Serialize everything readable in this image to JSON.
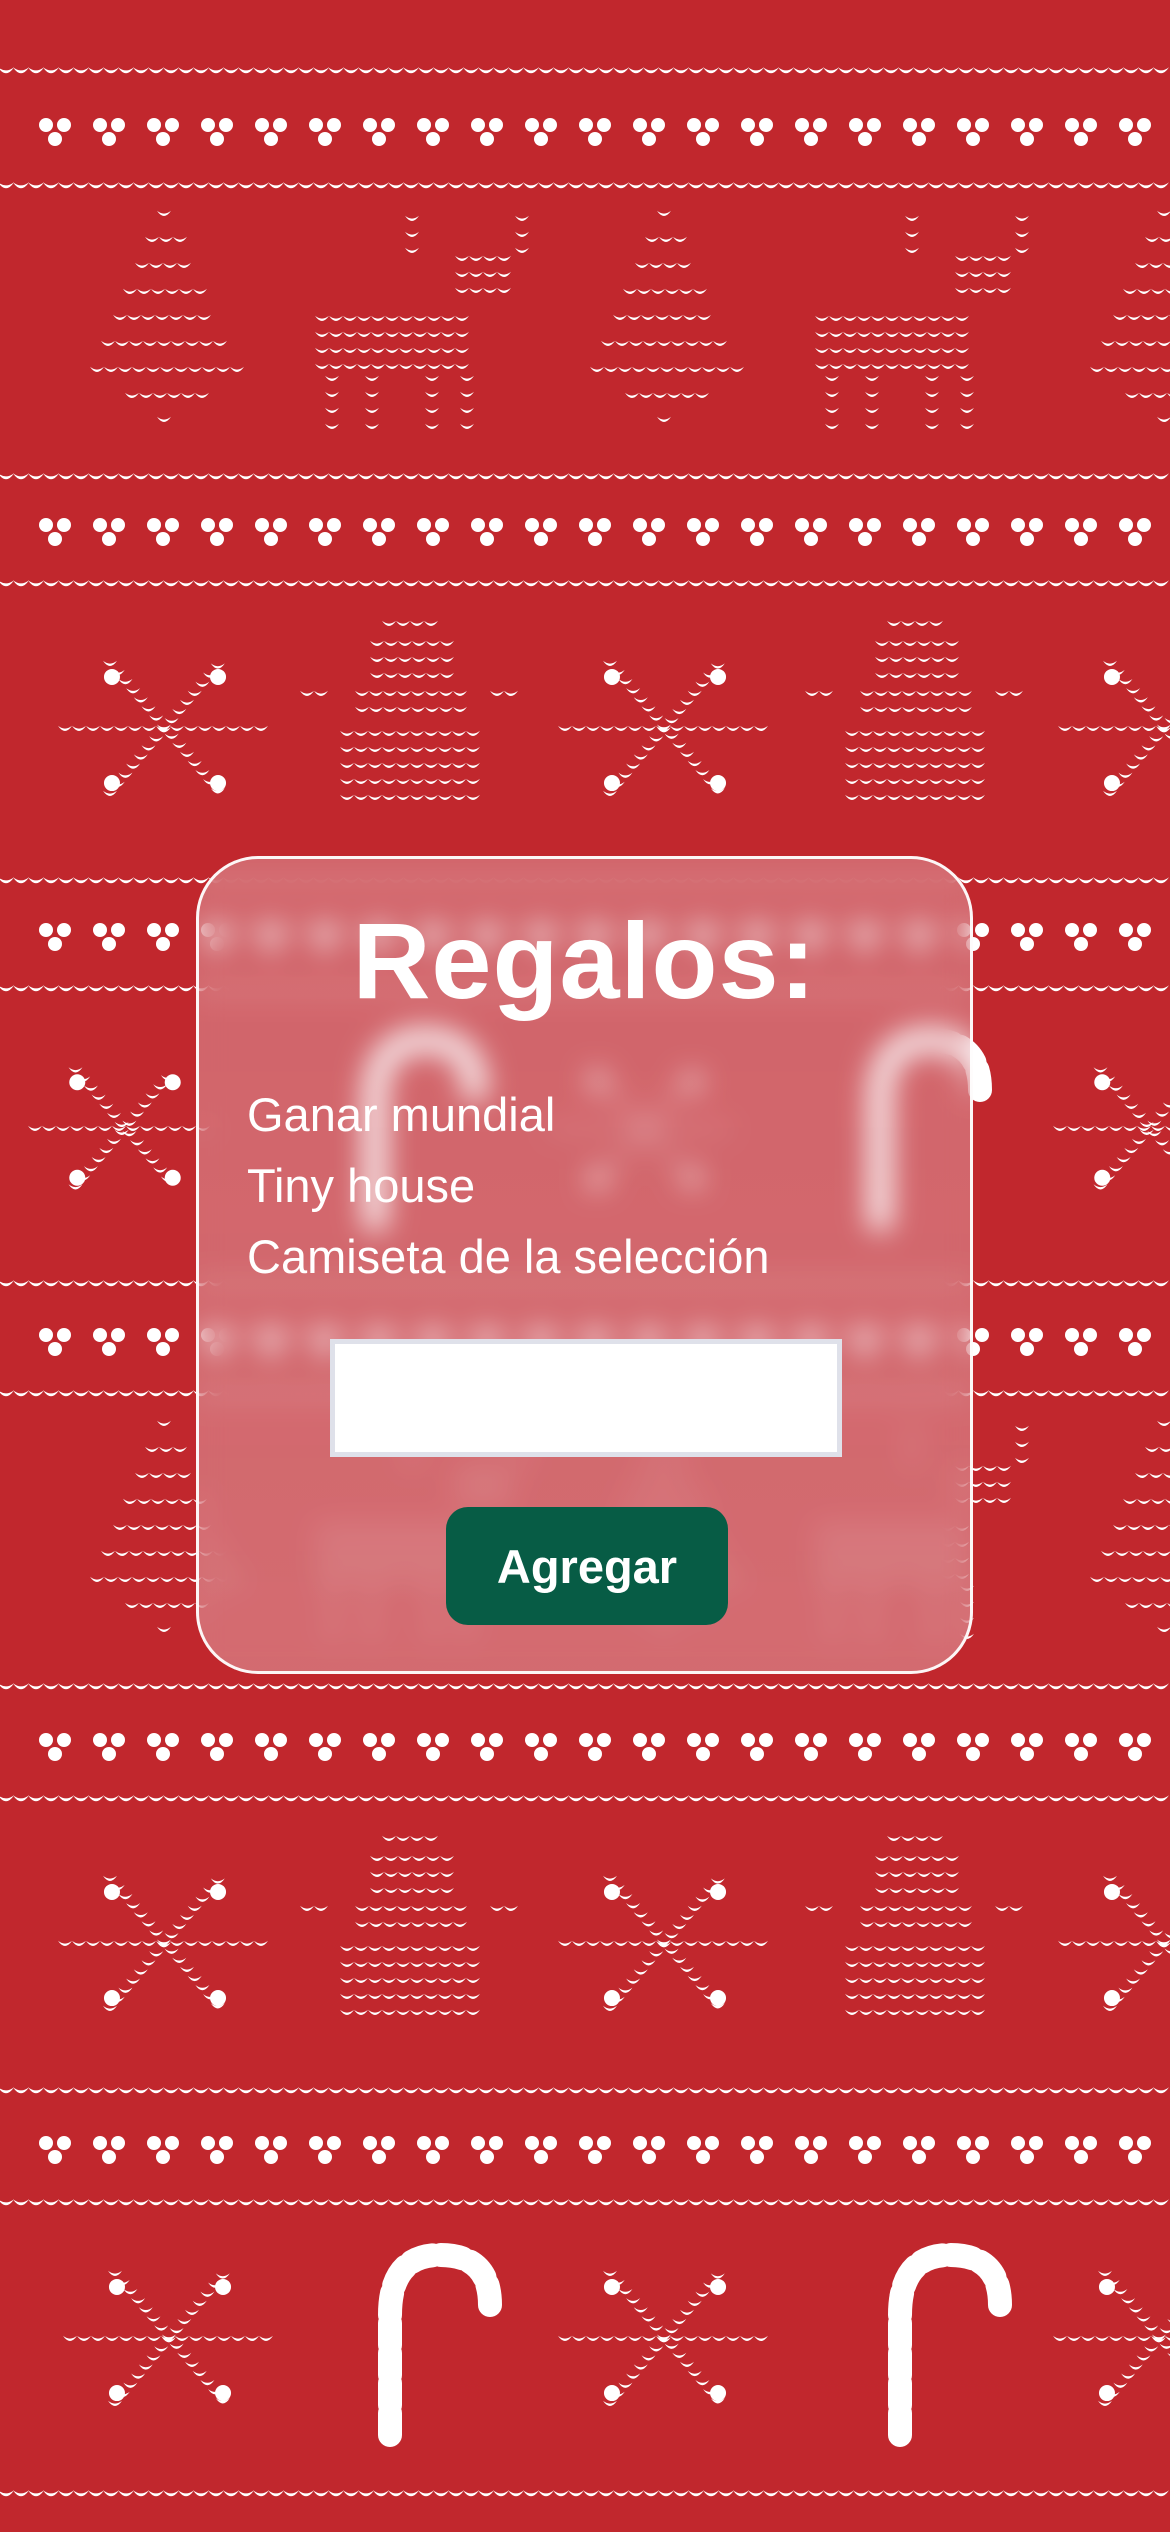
{
  "colors": {
    "background_red": "#c1272d",
    "pattern_white": "#ffffff",
    "button_green": "#075c45",
    "input_border": "#dfe1ea"
  },
  "background": {
    "pattern": "ugly-christmas-sweater knit",
    "motifs": [
      "tree-icon",
      "reindeer-icon",
      "snowflake-icon",
      "snowman-icon",
      "candy-cane-icon",
      "heart-dots-icon"
    ]
  },
  "card": {
    "title": "Regalos:",
    "gifts": [
      "Ganar mundial",
      "Tiny house",
      "Camiseta de la selección"
    ],
    "input": {
      "value": "",
      "placeholder": ""
    },
    "add_button_label": "Agregar"
  }
}
